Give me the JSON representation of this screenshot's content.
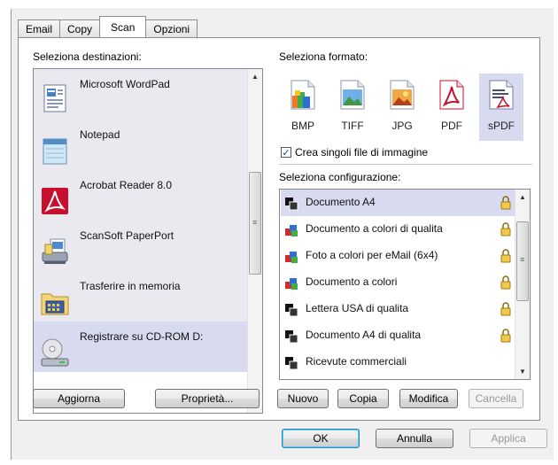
{
  "tabs": [
    {
      "label": "Email"
    },
    {
      "label": "Copy"
    },
    {
      "label": "Scan"
    },
    {
      "label": "Opzioni"
    }
  ],
  "destinations": {
    "heading": "Seleziona destinazioni:",
    "items": [
      {
        "label": "Microsoft WordPad"
      },
      {
        "label": "Notepad"
      },
      {
        "label": "Acrobat Reader 8.0"
      },
      {
        "label": "ScanSoft PaperPort"
      },
      {
        "label": "Trasferire in memoria"
      },
      {
        "label": "Registrare su CD-ROM  D:"
      }
    ],
    "buttons": {
      "refresh": "Aggiorna",
      "properties": "Proprietà..."
    }
  },
  "format": {
    "heading": "Seleziona formato:",
    "items": [
      {
        "label": "BMP"
      },
      {
        "label": "TIFF"
      },
      {
        "label": "JPG"
      },
      {
        "label": "PDF"
      },
      {
        "label": "sPDF"
      }
    ],
    "checkbox_label": "Crea singoli file di immagine",
    "checkbox_checked": true
  },
  "configuration": {
    "heading": "Seleziona configurazione:",
    "items": [
      {
        "label": "Documento A4"
      },
      {
        "label": "Documento a colori di qualita"
      },
      {
        "label": "Foto a colori per eMail (6x4)"
      },
      {
        "label": "Documento a colori"
      },
      {
        "label": "Lettera USA di qualita"
      },
      {
        "label": "Documento A4 di qualita"
      },
      {
        "label": "Ricevute commerciali"
      }
    ],
    "buttons": {
      "new": "Nuovo",
      "copy": "Copia",
      "modify": "Modifica",
      "delete": "Cancella"
    }
  },
  "dialog_buttons": {
    "ok": "OK",
    "cancel": "Annulla",
    "apply": "Applica"
  },
  "colors": {
    "selection": "#d8daf0",
    "accent": "#3c7fb1"
  }
}
